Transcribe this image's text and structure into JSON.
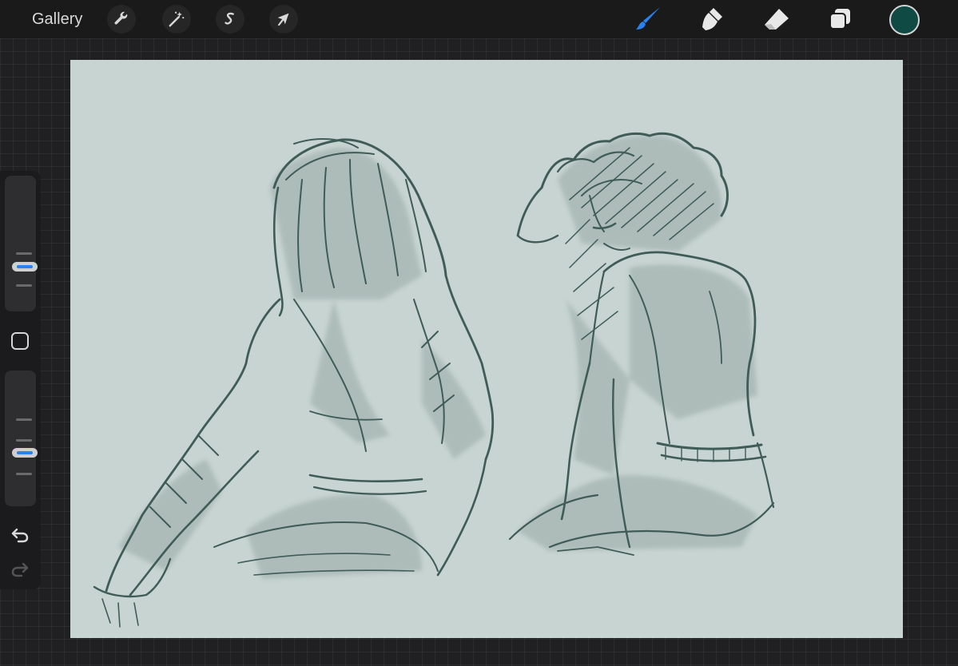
{
  "topbar": {
    "gallery_label": "Gallery",
    "left_tools": [
      {
        "name": "actions",
        "icon": "wrench-icon"
      },
      {
        "name": "adjustments",
        "icon": "magic-wand-icon"
      },
      {
        "name": "selection",
        "icon": "selection-s-icon"
      },
      {
        "name": "transform",
        "icon": "arrow-cursor-icon"
      }
    ],
    "right_tools": [
      {
        "name": "brush",
        "icon": "brush-icon",
        "active": true
      },
      {
        "name": "smudge",
        "icon": "smudge-finger-icon",
        "active": false
      },
      {
        "name": "eraser",
        "icon": "eraser-icon",
        "active": false
      },
      {
        "name": "layers",
        "icon": "layers-icon",
        "active": false
      }
    ],
    "current_color": "#0f4a45"
  },
  "colors": {
    "topbar_bg": "#1a1a1a",
    "workspace_bg": "#202022",
    "canvas_bg": "#c8d4d1",
    "sketch_stroke": "#3f5c57",
    "accent_blue": "#2a82f0"
  },
  "sidebar": {
    "brush_size_level": 0.55,
    "opacity_level": 0.35,
    "modify_icon": "square-modify-icon",
    "undo_icon": "undo-icon",
    "redo_icon": "redo-icon"
  },
  "canvas": {
    "content": "sketch"
  }
}
